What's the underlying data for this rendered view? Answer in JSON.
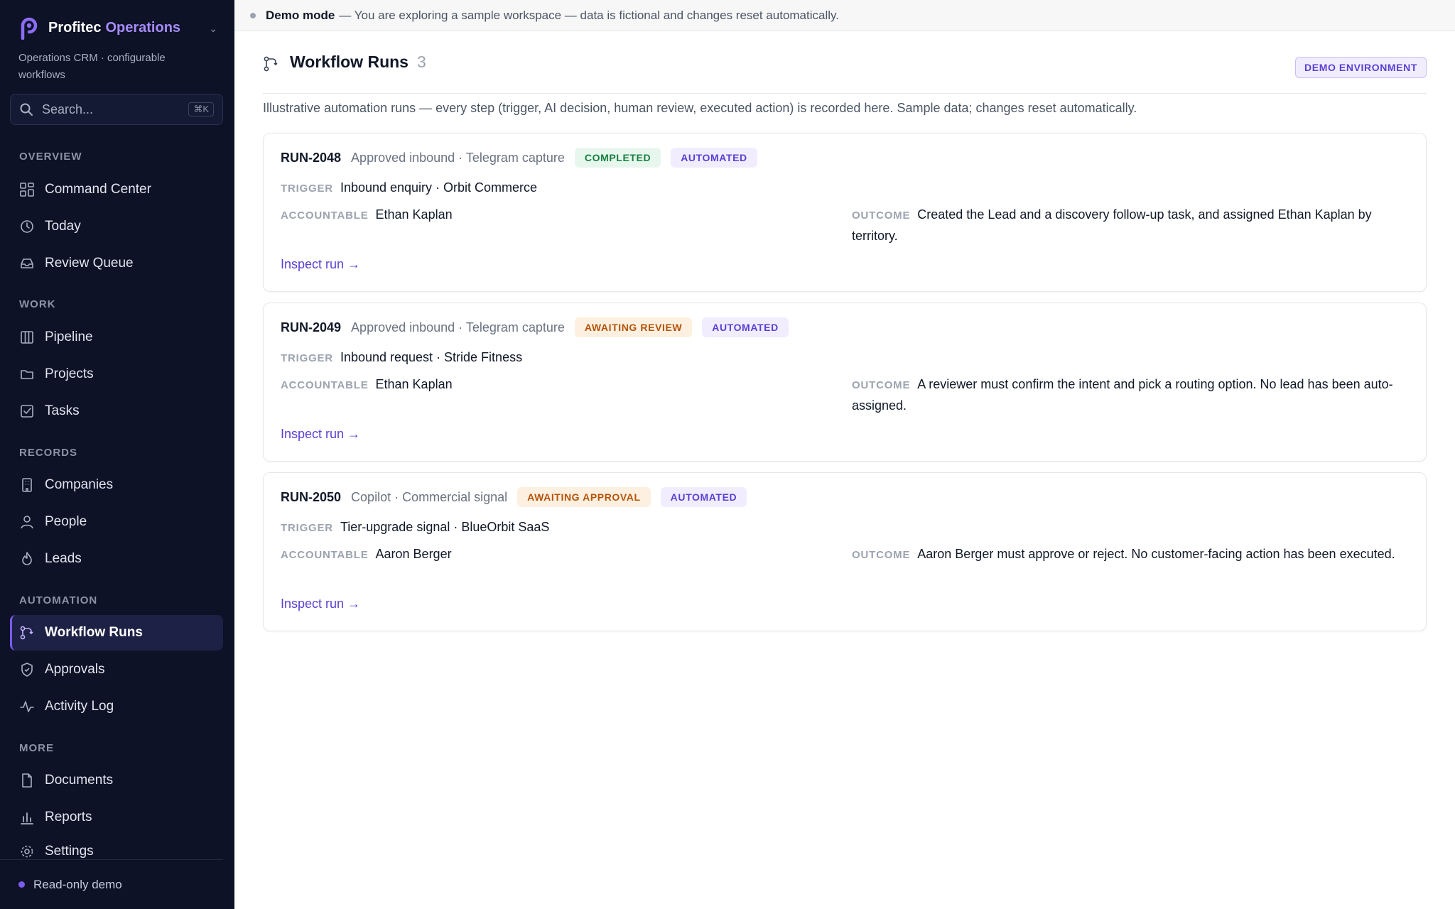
{
  "brand": {
    "name": "Profitec",
    "accent": "Operations",
    "subtitle": "Operations CRM · configurable workflows"
  },
  "search": {
    "placeholder": "Search...",
    "shortcut": "⌘K"
  },
  "nav": {
    "overview": "OVERVIEW",
    "overview_items": [
      "Command Center",
      "Today",
      "Review Queue"
    ],
    "work": "WORK",
    "work_items": [
      "Pipeline",
      "Projects",
      "Tasks"
    ],
    "records": "RECORDS",
    "records_items": [
      "Companies",
      "People",
      "Leads"
    ],
    "automation": "AUTOMATION",
    "automation_items": [
      "Workflow Runs",
      "Approvals",
      "Activity Log"
    ],
    "more": "MORE",
    "more_items": [
      "Documents",
      "Reports",
      "Settings"
    ],
    "active": "Workflow Runs"
  },
  "footer": {
    "label": "Read-only demo"
  },
  "banner": {
    "title": "Demo mode",
    "text": "— You are exploring a sample workspace — data is fictional and changes reset automatically."
  },
  "page": {
    "title": "Workflow Runs",
    "count": "3",
    "env_badge": "DEMO ENVIRONMENT",
    "description": "Illustrative automation runs — every step (trigger, AI decision, human review, executed action) is recorded here. Sample data; changes reset automatically."
  },
  "labels": {
    "trigger": "TRIGGER",
    "accountable": "ACCOUNTABLE",
    "outcome": "OUTCOME",
    "inspect": "Inspect run →"
  },
  "runs": [
    {
      "id": "RUN-2048",
      "source": "Approved inbound · Telegram capture",
      "status": "COMPLETED",
      "mode": "AUTOMATED",
      "trigger": "Inbound enquiry · Orbit Commerce",
      "accountable": "Ethan Kaplan",
      "outcome": "Created the Lead and a discovery follow-up task, and assigned Ethan Kaplan by territory."
    },
    {
      "id": "RUN-2049",
      "source": "Approved inbound · Telegram capture",
      "status": "AWAITING REVIEW",
      "mode": "AUTOMATED",
      "trigger": "Inbound request · Stride Fitness",
      "accountable": "Ethan Kaplan",
      "outcome": "A reviewer must confirm the intent and pick a routing option. No lead has been auto-assigned."
    },
    {
      "id": "RUN-2050",
      "source": "Copilot · Commercial signal",
      "status": "AWAITING APPROVAL",
      "mode": "AUTOMATED",
      "trigger": "Tier-upgrade signal · BlueOrbit SaaS",
      "accountable": "Aaron Berger",
      "outcome": "Aaron Berger must approve or reject. No customer-facing action has been executed."
    }
  ]
}
